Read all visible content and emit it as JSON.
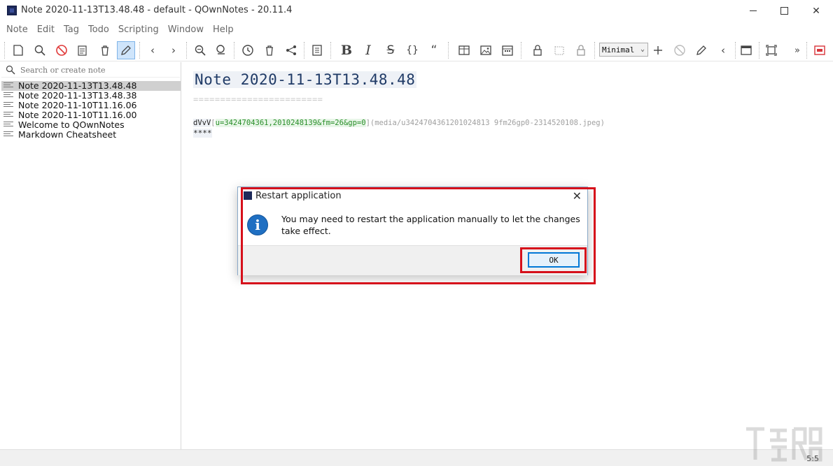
{
  "window": {
    "title": "Note 2020-11-13T13.48.48 - default - QOwnNotes - 20.11.4",
    "close_glyph": "✕"
  },
  "menu": [
    "Note",
    "Edit",
    "Tag",
    "Todo",
    "Scripting",
    "Window",
    "Help"
  ],
  "toolbar": {
    "view_mode": "Minimal",
    "italic_glyph": "I",
    "bold_glyph": "B",
    "strike_glyph": "S",
    "code_glyph": "{}",
    "quote_glyph": "“",
    "prev_glyph": "‹",
    "next_glyph": "›",
    "overflow_glyph": "»"
  },
  "sidebar": {
    "search_placeholder": "Search or create note",
    "notes": [
      {
        "title": "Note 2020-11-13T13.48.48",
        "selected": true
      },
      {
        "title": "Note 2020-11-13T13.48.38",
        "selected": false
      },
      {
        "title": "Note 2020-11-10T11.16.06",
        "selected": false
      },
      {
        "title": "Note 2020-11-10T11.16.00",
        "selected": false
      },
      {
        "title": "Welcome to QOwnNotes",
        "selected": false
      },
      {
        "title": "Markdown Cheatsheet",
        "selected": false
      }
    ]
  },
  "editor": {
    "title": "Note 2020-11-13T13.48.48",
    "underline": "========================",
    "image_alt": "dVvV",
    "image_link_open": "[",
    "image_link_text": "u=3424704361,2010248139&fm=26&gp=0",
    "image_link_close": "]",
    "image_url": "(media/u3424704361201024813 9fm26gp0-2314520108.jpeg)",
    "stars": "****"
  },
  "dialog": {
    "title": "Restart application",
    "close_glyph": "✕",
    "info_glyph": "i",
    "message": "You may need to restart the application manually to let the changes take effect.",
    "ok_label": "OK"
  },
  "status": {
    "cursor_position": "5:5"
  },
  "colors": {
    "highlight": "#d6101b",
    "accent": "#0078d7",
    "link_green": "#2a8f2a",
    "title_navy": "#1f3a66"
  }
}
